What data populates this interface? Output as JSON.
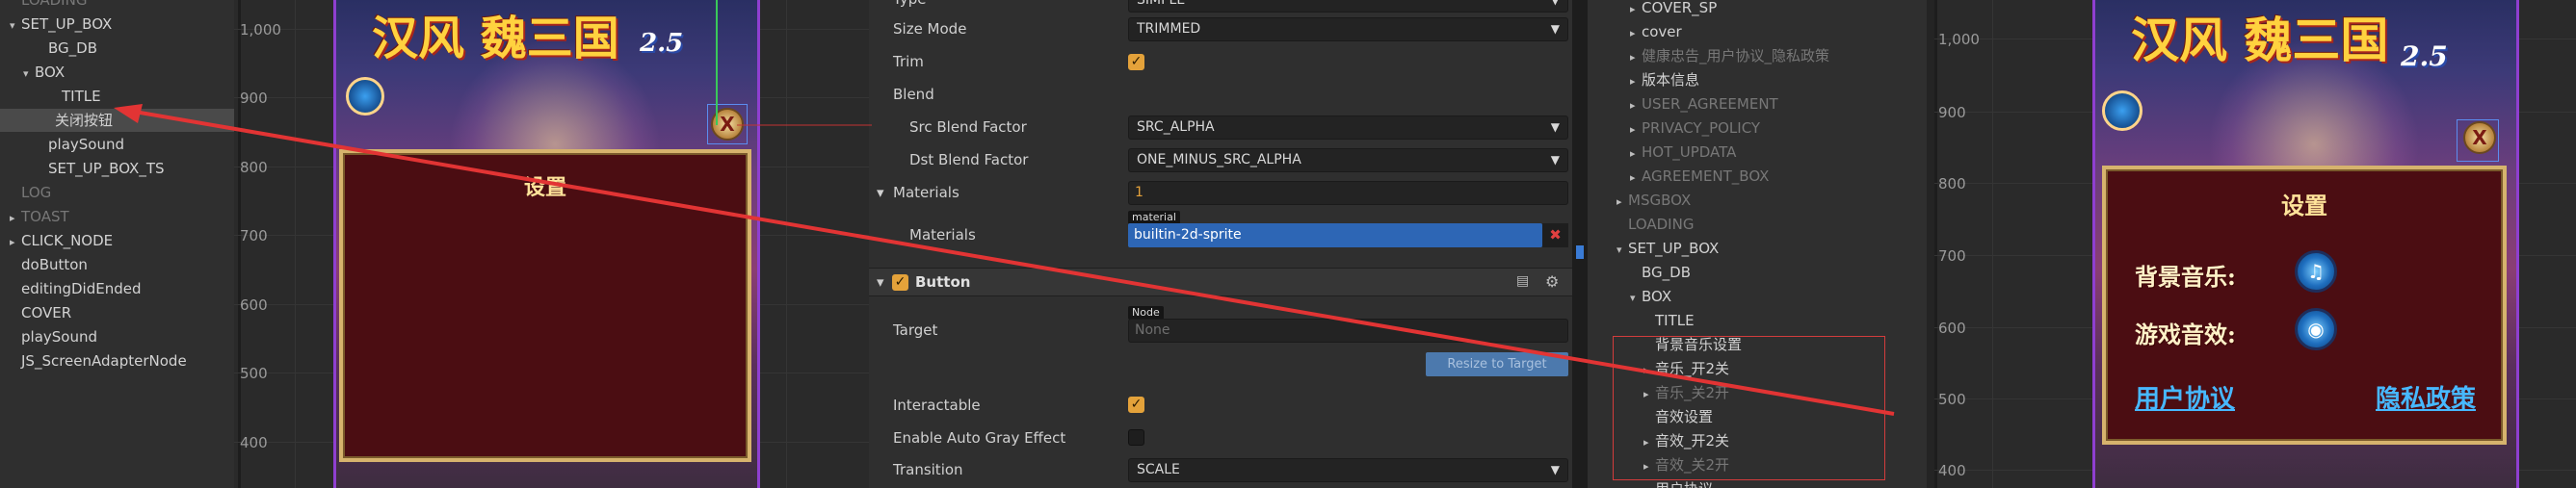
{
  "left_hierarchy": {
    "items": [
      {
        "label": "LOADING",
        "indent": 0,
        "arrow": "",
        "dim": true
      },
      {
        "label": "SET_UP_BOX",
        "indent": 0,
        "arrow": "▾",
        "dim": false
      },
      {
        "label": "BG_DB",
        "indent": 2,
        "arrow": "",
        "dim": false
      },
      {
        "label": "BOX",
        "indent": 1,
        "arrow": "▾",
        "dim": false
      },
      {
        "label": "TITLE",
        "indent": 3,
        "arrow": "",
        "dim": false
      },
      {
        "label": "关闭按钮",
        "indent": 2,
        "arrow": "",
        "dim": false,
        "selected": true
      },
      {
        "label": "playSound",
        "indent": 2,
        "arrow": "",
        "dim": false
      },
      {
        "label": "SET_UP_BOX_TS",
        "indent": 2,
        "arrow": "",
        "dim": false
      },
      {
        "label": "LOG",
        "indent": 0,
        "arrow": "",
        "dim": true
      },
      {
        "label": "TOAST",
        "indent": 0,
        "arrow": "▸",
        "dim": true
      },
      {
        "label": "CLICK_NODE",
        "indent": 0,
        "arrow": "▸",
        "dim": false
      },
      {
        "label": "doButton",
        "indent": 0,
        "arrow": "",
        "dim": false
      },
      {
        "label": "editingDidEnded",
        "indent": 0,
        "arrow": "",
        "dim": false
      },
      {
        "label": "COVER",
        "indent": 0,
        "arrow": "",
        "dim": false
      },
      {
        "label": "playSound",
        "indent": 0,
        "arrow": "",
        "dim": false
      },
      {
        "label": "JS_ScreenAdapterNode",
        "indent": 0,
        "arrow": "",
        "dim": false
      }
    ]
  },
  "scene1": {
    "y_labels": [
      "1,000",
      "900",
      "800",
      "700",
      "600",
      "500",
      "400"
    ],
    "logo_text": "汉风 魏三国",
    "logo_num": "2.5",
    "dialog_title": "设置",
    "close_glyph": "X"
  },
  "inspector": {
    "rows": [
      {
        "label": "Type",
        "kind": "select",
        "value": "SIMPLE"
      },
      {
        "label": "Size Mode",
        "kind": "select",
        "value": "TRIMMED"
      },
      {
        "label": "Trim",
        "kind": "check",
        "value": true
      },
      {
        "label": "Blend",
        "kind": "none"
      },
      {
        "label": "Src Blend Factor",
        "kind": "select",
        "value": "SRC_ALPHA"
      },
      {
        "label": "Dst Blend Factor",
        "kind": "select",
        "value": "ONE_MINUS_SRC_ALPHA"
      }
    ],
    "materials_label": "Materials",
    "materials_count": "1",
    "materials_sub_label": "Materials",
    "material_tag": "material",
    "material_value": "builtin-2d-sprite",
    "button_section": "Button",
    "target_label": "Target",
    "node_tag": "Node",
    "target_placeholder": "None",
    "resize_button": "Resize to Target",
    "interactable_label": "Interactable",
    "auto_gray_label": "Enable Auto Gray Effect",
    "transition_label": "Transition",
    "transition_value": "SCALE"
  },
  "right_hierarchy": {
    "items": [
      {
        "label": "COVER_SP",
        "indent": 1,
        "arrow": "▸",
        "dim": false
      },
      {
        "label": "cover",
        "indent": 1,
        "arrow": "▸",
        "dim": false
      },
      {
        "label": "健康忠告_用户协议_隐私政策",
        "indent": 1,
        "arrow": "▸",
        "dim": true
      },
      {
        "label": "版本信息",
        "indent": 1,
        "arrow": "▸",
        "dim": false
      },
      {
        "label": "USER_AGREEMENT",
        "indent": 1,
        "arrow": "▸",
        "dim": true
      },
      {
        "label": "PRIVACY_POLICY",
        "indent": 1,
        "arrow": "▸",
        "dim": true
      },
      {
        "label": "HOT_UPDATA",
        "indent": 1,
        "arrow": "▸",
        "dim": true
      },
      {
        "label": "AGREEMENT_BOX",
        "indent": 1,
        "arrow": "▸",
        "dim": true
      },
      {
        "label": "MSGBOX",
        "indent": 0,
        "arrow": "▸",
        "dim": true
      },
      {
        "label": "LOADING",
        "indent": 0,
        "arrow": "",
        "dim": true
      },
      {
        "label": "SET_UP_BOX",
        "indent": 0,
        "arrow": "▾",
        "dim": false
      },
      {
        "label": "BG_DB",
        "indent": 1,
        "arrow": "",
        "dim": false
      },
      {
        "label": "BOX",
        "indent": 1,
        "arrow": "▾",
        "dim": false
      },
      {
        "label": "TITLE",
        "indent": 2,
        "arrow": "",
        "dim": false
      },
      {
        "label": "背景音乐设置",
        "indent": 2,
        "arrow": "",
        "dim": false
      },
      {
        "label": "音乐_开2关",
        "indent": 2,
        "arrow": "▸",
        "dim": false
      },
      {
        "label": "音乐_关2开",
        "indent": 2,
        "arrow": "▸",
        "dim": true
      },
      {
        "label": "音效设置",
        "indent": 2,
        "arrow": "",
        "dim": false
      },
      {
        "label": "音效_开2关",
        "indent": 2,
        "arrow": "▸",
        "dim": false
      },
      {
        "label": "音效_关2开",
        "indent": 2,
        "arrow": "▸",
        "dim": true
      },
      {
        "label": "用户协议",
        "indent": 2,
        "arrow": "",
        "dim": false
      }
    ]
  },
  "scene2": {
    "y_labels": [
      "1,000",
      "900",
      "800",
      "700",
      "600",
      "500",
      "400"
    ],
    "logo_text": "汉风 魏三国",
    "logo_num": "2.5",
    "dialog_title": "设置",
    "music_label": "背景音乐:",
    "sound_label": "游戏音效:",
    "user_agreement_link": "用户协议",
    "privacy_link": "隐私政策"
  },
  "colors": {
    "accent_check": "#e4a23a",
    "selection_blue": "#5b8df0",
    "annotation_red": "#e23434",
    "dialog_fill": "#4b0d12",
    "dialog_border": "#d6b36d"
  }
}
